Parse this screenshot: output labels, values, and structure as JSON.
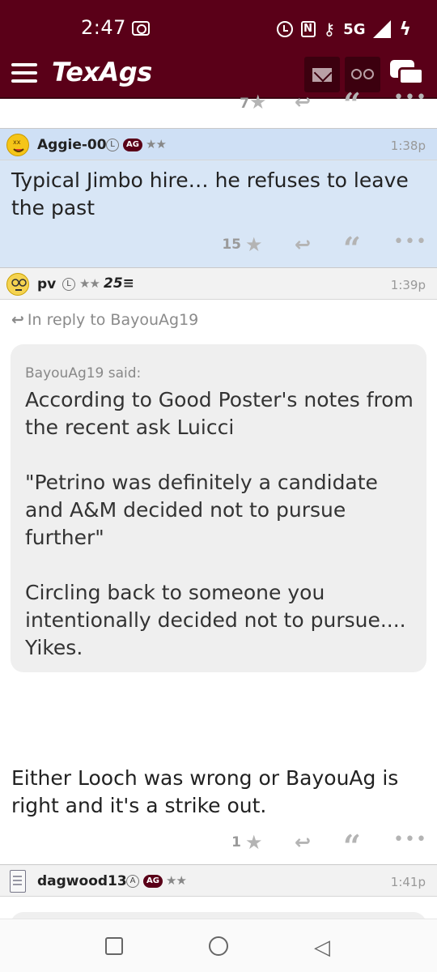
{
  "status_bar": {
    "time": "2:47",
    "network": "5G",
    "icons": [
      "screen-record-icon",
      "alarm-icon",
      "nfc-icon",
      "key-icon",
      "signal-icon",
      "charging-icon"
    ]
  },
  "header": {
    "logo": "TexAgs",
    "brand_color": "#5a0018",
    "icons": [
      "menu-icon",
      "mail-icon",
      "binoculars-icon",
      "chat-icon"
    ]
  },
  "prev_post_actions": {
    "count": "7"
  },
  "posts": [
    {
      "user": "Aggie-00",
      "badges": [
        "L",
        "AG"
      ],
      "stars": "★★",
      "time": "1:38p",
      "body": "Typical Jimbo hire… he refuses to leave the past",
      "actions": {
        "count": "15"
      },
      "highlight_color": "#d8e6f6"
    },
    {
      "user": "pv",
      "badges": [
        "L"
      ],
      "stars": "★★",
      "rank": "25",
      "time": "1:39p",
      "reply_to": "In reply to BayouAg19",
      "quote": {
        "by": "BayouAg19 said:",
        "paragraphs": [
          "According to Good Poster's notes from the recent ask Luicci",
          "\"Petrino was definitely a candidate and A&M decided not to pursue further\"",
          "Circling back to someone you intentionally decided not to pursue.... Yikes."
        ]
      },
      "body": "Either Looch was wrong or BayouAg is right and it's a strike out.",
      "actions": {
        "count": "1"
      }
    },
    {
      "user": "dagwood13",
      "badges": [
        "A",
        "AG"
      ],
      "stars": "★★",
      "time": "1:41p"
    }
  ],
  "nav": {
    "icons": [
      "recents-icon",
      "home-icon",
      "back-icon"
    ]
  }
}
